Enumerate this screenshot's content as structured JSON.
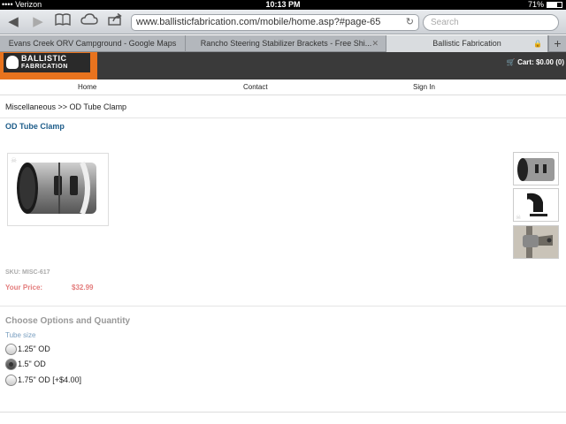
{
  "statusbar": {
    "carrier": "•••• Verizon",
    "time": "10:13 PM",
    "battery": "71%"
  },
  "toolbar": {
    "back_icon": "back-arrow-icon",
    "forward_icon": "forward-arrow-icon",
    "url": "www.ballisticfabrication.com/mobile/home.asp?#page-65",
    "search_placeholder": "Search"
  },
  "tabs": [
    {
      "label": "Evans Creek ORV Campground - Google Maps"
    },
    {
      "label": "Rancho Steering Stabilizer Brackets - Free Shi..."
    },
    {
      "label": "Ballistic Fabrication",
      "active": true
    }
  ],
  "site": {
    "logo_line1": "BALLISTIC",
    "logo_line2": "FABRICATION",
    "cart": "Cart: $0.00 (0)"
  },
  "nav": {
    "home": "Home",
    "contact": "Contact",
    "signin": "Sign In"
  },
  "breadcrumb": "Miscellaneous >> OD Tube Clamp",
  "product": {
    "title": "OD Tube Clamp",
    "sku": "SKU: MISC-617",
    "price_label": "Your Price:",
    "price": "$32.99"
  },
  "options": {
    "heading": "Choose Options and Quantity",
    "sub": "Tube size",
    "items": [
      {
        "label": "1.25\" OD",
        "checked": false
      },
      {
        "label": "1.5\" OD",
        "checked": true
      },
      {
        "label": "1.75\" OD [+$4.00]",
        "checked": false
      }
    ]
  },
  "colors": {
    "brand_orange": "#e8731e",
    "title_blue": "#1e5d8a",
    "price_red": "#e37c7c"
  }
}
